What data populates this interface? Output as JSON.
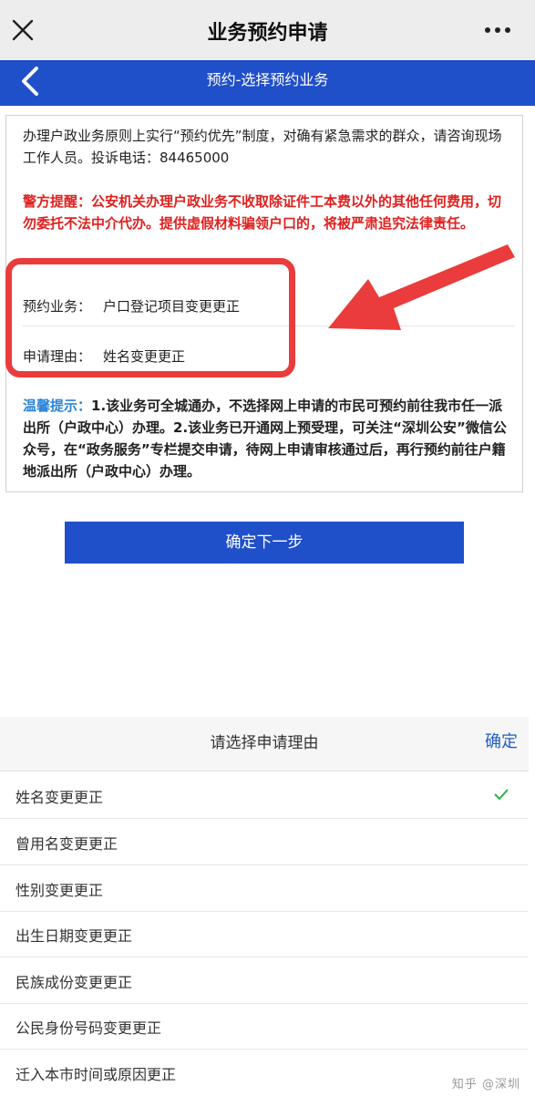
{
  "topbar": {
    "title": "业务预约申请",
    "close_icon": "close-icon",
    "more_icon": "more-icon"
  },
  "navbar": {
    "title": "预约-选择预约业务",
    "back_icon": "chevron-left-icon",
    "color": "#1f4fc9"
  },
  "notice": {
    "intro": "办理户政业务原则上实行“预约优先”制度，对确有紧急需求的群众，请咨询现场工作人员。投诉电话：84465000",
    "warning": "警方提醒：公安机关办理户政业务不收取除证件工本费以外的其他任何费用，切勿委托不法中介代办。提供虚假材料骗领户口的，将被严肃追究法律责任。",
    "warning_color": "#e0201e"
  },
  "fields": {
    "service_label": "预约业务：",
    "service_value": "户口登记项目变更更正",
    "reason_label": "申请理由：",
    "reason_value": "姓名变更更正"
  },
  "tip": {
    "label": "温馨提示：",
    "text": "1.该业务可全城通办，不选择网上申请的市民可预约前往我市任一派出所（户政中心）办理。2.该业务已开通网上预受理，可关注“深圳公安”微信公众号，在“政务服务”专栏提交申请，待网上申请审核通过后，再行预约前往户籍地派出所（户政中心）办理。"
  },
  "next_button": {
    "label": "确定下一步"
  },
  "picker": {
    "title": "请选择申请理由",
    "confirm": "确定",
    "options": [
      {
        "label": "姓名变更更正",
        "selected": true
      },
      {
        "label": "曾用名变更更正",
        "selected": false
      },
      {
        "label": "性别变更更正",
        "selected": false
      },
      {
        "label": "出生日期变更更正",
        "selected": false
      },
      {
        "label": "民族成份变更更正",
        "selected": false
      },
      {
        "label": "公民身份号码变更更正",
        "selected": false
      },
      {
        "label": "迁入本市时间或原因更正",
        "selected": false
      }
    ],
    "check_icon": "check-icon",
    "check_color": "#2db24a"
  },
  "watermark": "知乎 @深圳"
}
